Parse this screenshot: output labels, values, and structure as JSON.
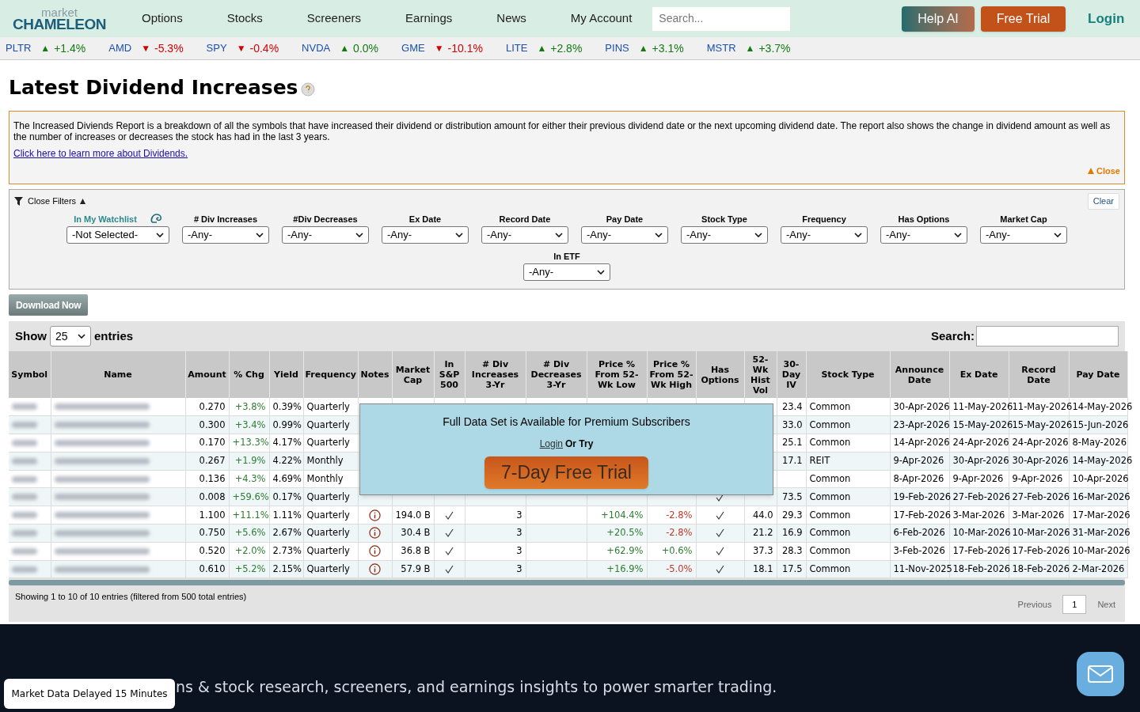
{
  "header": {
    "logo_top": "market",
    "logo_bottom": "CHAMELEON",
    "nav": [
      "Options",
      "Stocks",
      "Screeners",
      "Earnings",
      "News",
      "My Account"
    ],
    "search": {
      "placeholder": "Search..."
    },
    "help_button": "Help AI",
    "trial_button": "Free Trial",
    "login": "Login"
  },
  "ticker": [
    {
      "symbol": "PLTR",
      "arrow": "▲",
      "color": "#137a13",
      "change": "+1.4%"
    },
    {
      "symbol": "AMD",
      "arrow": "▼",
      "color": "#d40000",
      "change": "-5.3%"
    },
    {
      "symbol": "SPY",
      "arrow": "▼",
      "color": "#d40000",
      "change": "-0.4%"
    },
    {
      "symbol": "NVDA",
      "arrow": "▲",
      "color": "#137a13",
      "change": "0.0%"
    },
    {
      "symbol": "GME",
      "arrow": "▼",
      "color": "#d40000",
      "change": "-10.1%"
    },
    {
      "symbol": "LITE",
      "arrow": "▲",
      "color": "#137a13",
      "change": "+2.8%"
    },
    {
      "symbol": "PINS",
      "arrow": "▲",
      "color": "#137a13",
      "change": "+3.1%"
    },
    {
      "symbol": "MSTR",
      "arrow": "▲",
      "color": "#137a13",
      "change": "+3.7%"
    }
  ],
  "title": "Latest Dividend Increases",
  "info": {
    "text": "The Increased Diviends Report is a breakdown of all the symbols that have increased their dividend or distribution amount for either their previous dividend date or the next upcoming dividend date. The report also shows the change in dividend amount as well as the number of increases or decreases the stock has had in the last 3 years.",
    "link": "Click here to learn more about Dividends.",
    "close": "Close"
  },
  "filters": {
    "toggle": "Close Filters",
    "clear": "Clear",
    "items": [
      {
        "label": "In My Watchlist",
        "value": "-Not Selected-",
        "kind": "watchlist"
      },
      {
        "label": "# Div Increases",
        "value": "-Any-",
        "kind": "select"
      },
      {
        "label": "#Div Decreases",
        "value": "-Any-",
        "kind": "select"
      },
      {
        "label": "Ex Date",
        "value": "-Any-",
        "kind": "select"
      },
      {
        "label": "Record Date",
        "value": "-Any-",
        "kind": "select"
      },
      {
        "label": "Pay Date",
        "value": "-Any-",
        "kind": "select"
      },
      {
        "label": "Stock Type",
        "value": "-Any-",
        "kind": "select"
      },
      {
        "label": "Frequency",
        "value": "-Any-",
        "kind": "select"
      },
      {
        "label": "Has Options",
        "value": "-Any-",
        "kind": "select"
      },
      {
        "label": "Market Cap",
        "value": "-Any-",
        "kind": "select"
      },
      {
        "label": "In ETF",
        "value": "-Any-",
        "kind": "select"
      }
    ]
  },
  "download_button": "Download Now",
  "table_controls": {
    "show": "Show",
    "page_size": "25",
    "entries": "entries",
    "search_label": "Search:"
  },
  "table": {
    "columns": [
      "Symbol",
      "Name",
      "Amount",
      "% Chg",
      "Yield",
      "Frequency",
      "Notes",
      "Market Cap",
      "In S&P 500",
      "# Div Increases 3-Yr",
      "# Div Decreases 3-Yr",
      "Price % From 52-Wk Low",
      "Price % From 52-Wk High",
      "Has Options",
      "52-Wk Hist Vol",
      "30-Day IV",
      "Stock Type",
      "Announce Date",
      "Ex Date",
      "Record Date",
      "Pay Date"
    ],
    "rows": [
      {
        "amount": "0.270",
        "chg": "+3.8%",
        "yield": "0.39%",
        "frequency": "Quarterly",
        "iv": "23.4",
        "stock_type": "Common",
        "announce": "30-Apr-2026",
        "ex": "11-May-2026",
        "record": "11-May-2026",
        "pay": "14-May-2026"
      },
      {
        "amount": "0.300",
        "chg": "+3.4%",
        "yield": "0.99%",
        "frequency": "Quarterly",
        "iv": "33.0",
        "stock_type": "Common",
        "announce": "23-Apr-2026",
        "ex": "15-May-2026",
        "record": "15-May-2026",
        "pay": "15-Jun-2026"
      },
      {
        "amount": "0.170",
        "chg": "+13.3%",
        "yield": "4.17%",
        "frequency": "Quarterly",
        "iv": "25.1",
        "stock_type": "Common",
        "announce": "14-Apr-2026",
        "ex": "24-Apr-2026",
        "record": "24-Apr-2026",
        "pay": "8-May-2026"
      },
      {
        "amount": "0.267",
        "chg": "+1.9%",
        "yield": "4.22%",
        "frequency": "Monthly",
        "iv": "17.1",
        "stock_type": "REIT",
        "announce": "9-Apr-2026",
        "ex": "30-Apr-2026",
        "record": "30-Apr-2026",
        "pay": "14-May-2026"
      },
      {
        "amount": "0.136",
        "chg": "+4.3%",
        "yield": "4.69%",
        "frequency": "Monthly",
        "stock_type": "Common",
        "announce": "8-Apr-2026",
        "ex": "9-Apr-2026",
        "record": "9-Apr-2026",
        "pay": "10-Apr-2026"
      },
      {
        "amount": "0.008",
        "chg": "+59.6%",
        "yield": "0.17%",
        "frequency": "Quarterly",
        "has_options": true,
        "iv": "73.5",
        "stock_type": "Common",
        "announce": "19-Feb-2026",
        "ex": "27-Feb-2026",
        "record": "27-Feb-2026",
        "pay": "16-Mar-2026"
      },
      {
        "amount": "1.100",
        "chg": "+11.1%",
        "yield": "1.11%",
        "frequency": "Quarterly",
        "note": true,
        "market_cap": "194.0 B",
        "in_sp500": true,
        "div_inc": "3",
        "from_low": "+104.4%",
        "from_high": "-2.8%",
        "high_down": true,
        "has_options": true,
        "hist_vol": "44.0",
        "iv": "29.3",
        "stock_type": "Common",
        "announce": "17-Feb-2026",
        "ex": "3-Mar-2026",
        "record": "3-Mar-2026",
        "pay": "17-Mar-2026"
      },
      {
        "amount": "0.750",
        "chg": "+5.6%",
        "yield": "2.67%",
        "frequency": "Quarterly",
        "note": true,
        "market_cap": "30.4 B",
        "in_sp500": true,
        "div_inc": "3",
        "from_low": "+20.5%",
        "from_high": "-2.8%",
        "high_down": true,
        "has_options": true,
        "hist_vol": "21.2",
        "iv": "16.9",
        "stock_type": "Common",
        "announce": "6-Feb-2026",
        "ex": "10-Mar-2026",
        "record": "10-Mar-2026",
        "pay": "31-Mar-2026"
      },
      {
        "amount": "0.520",
        "chg": "+2.0%",
        "yield": "2.73%",
        "frequency": "Quarterly",
        "note": true,
        "market_cap": "36.8 B",
        "in_sp500": true,
        "div_inc": "3",
        "from_low": "+62.9%",
        "from_high": "+0.6%",
        "high_down": false,
        "has_options": true,
        "hist_vol": "37.3",
        "iv": "28.3",
        "stock_type": "Common",
        "announce": "3-Feb-2026",
        "ex": "17-Feb-2026",
        "record": "17-Feb-2026",
        "pay": "10-Mar-2026"
      },
      {
        "amount": "0.610",
        "chg": "+5.2%",
        "yield": "2.15%",
        "frequency": "Quarterly",
        "note": true,
        "market_cap": "57.9 B",
        "in_sp500": true,
        "div_inc": "3",
        "from_low": "+16.9%",
        "from_high": "-5.0%",
        "high_down": true,
        "has_options": true,
        "hist_vol": "18.1",
        "iv": "17.5",
        "stock_type": "Common",
        "announce": "11-Nov-2025",
        "ex": "18-Feb-2026",
        "record": "18-Feb-2026",
        "pay": "2-Mar-2026"
      }
    ]
  },
  "premium_overlay": {
    "message": "Full Data Set is Available for Premium Subscribers",
    "login": "Login",
    "or_try": "Or Try",
    "trial_button": "7-Day Free Trial"
  },
  "table_footer": {
    "summary": "Showing 1 to 10 of 10 entries (filtered from 500 total entries)",
    "previous": "Previous",
    "page": "1",
    "next": "Next"
  },
  "footer": {
    "tagline": "ns & stock research, screeners, and earnings insights to power smarter trading.",
    "delay_badge": "Market Data Delayed 15 Minutes"
  }
}
